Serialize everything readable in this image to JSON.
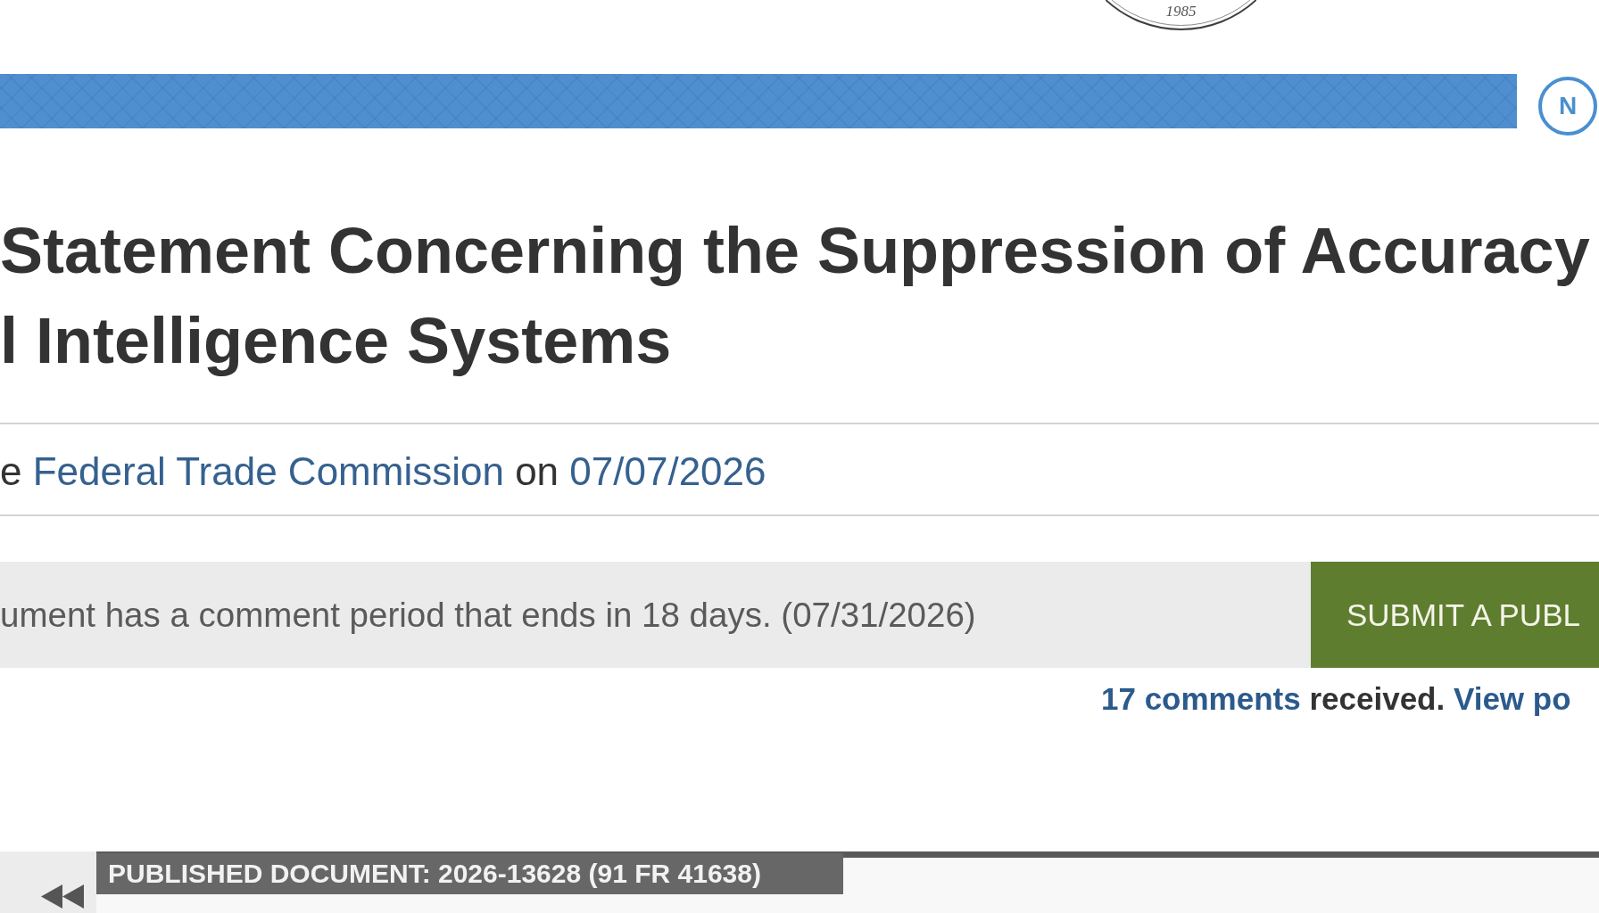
{
  "header": {
    "seal": {
      "year": "1985"
    },
    "document_type_badge": {
      "letter": "N"
    }
  },
  "title_lines": [
    "Statement Concerning the Suppression of Accuracy",
    "l Intelligence Systems"
  ],
  "publication_info": {
    "prefix": "e",
    "agency": "Federal Trade Commission",
    "joiner": "on",
    "date": "07/07/2026"
  },
  "comment_period": {
    "notice": "ument has a comment period that ends in 18 days. (07/31/2026)",
    "button": "SUBMIT A PUBL"
  },
  "comments_summary": {
    "count_link": "17 comments",
    "text": "received.",
    "view_link": "View po"
  },
  "bottom_panel": {
    "label": "PUBLISHED DOCUMENT: 2026-13628 (91 FR 41638)"
  }
}
